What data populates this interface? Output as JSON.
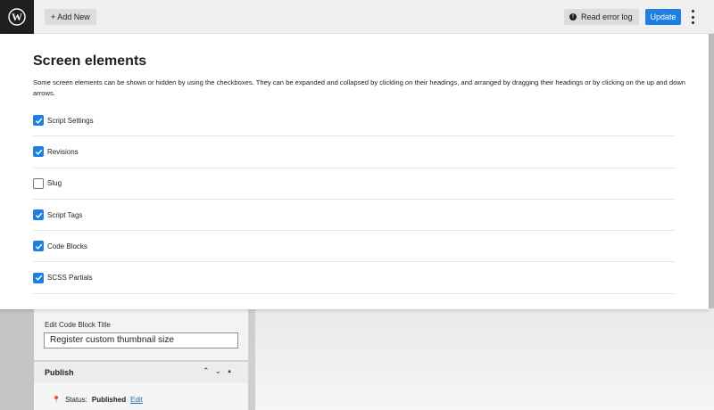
{
  "topbar": {
    "add_new_label": "+ Add New",
    "error_log_label": "Read error log",
    "update_label": "Update"
  },
  "screen_elements": {
    "title": "Screen elements",
    "description": "Some screen elements can be shown or hidden by using the checkboxes. They can be expanded and collapsed by clickling on their headings, and arranged by dragging their headings or by clicking on the up and down arrows.",
    "options": [
      {
        "label": "Script Settings",
        "checked": true
      },
      {
        "label": "Revisions",
        "checked": true
      },
      {
        "label": "Slug",
        "checked": false
      },
      {
        "label": "Script Tags",
        "checked": true
      },
      {
        "label": "Code Blocks",
        "checked": true
      },
      {
        "label": "SCSS Partials",
        "checked": true
      }
    ]
  },
  "sidebar": {
    "code_block_title_label": "Edit Code Block Title",
    "code_block_title_value": "Register custom thumbnail size",
    "publish_heading": "Publish",
    "status_label": "Status:",
    "status_value": "Published",
    "edit_link": "Edit"
  },
  "colors": {
    "accent": "#1e7fe0",
    "wp_black": "#1e1e1e"
  }
}
